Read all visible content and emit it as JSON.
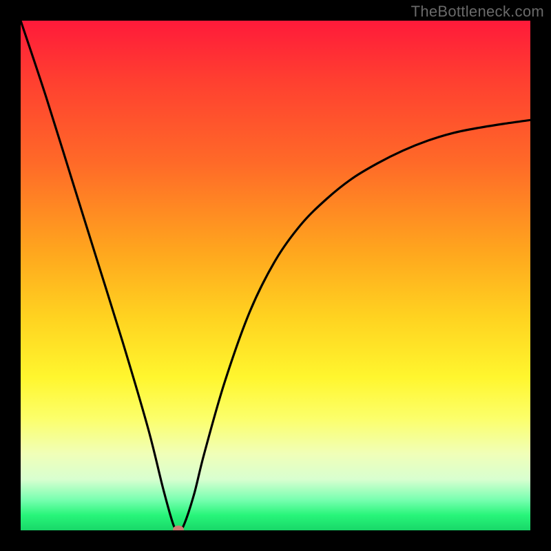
{
  "watermark": "TheBottleneck.com",
  "colors": {
    "frame": "#000000",
    "curve": "#000000",
    "marker": "#cb7f73"
  },
  "chart_data": {
    "type": "line",
    "title": "",
    "xlabel": "",
    "ylabel": "",
    "xlim": [
      0,
      100
    ],
    "ylim": [
      0,
      100
    ],
    "grid": false,
    "legend": false,
    "series": [
      {
        "name": "bottleneck-curve",
        "x": [
          0,
          5,
          10,
          15,
          20,
          25,
          28,
          30,
          31,
          32,
          34,
          36,
          40,
          45,
          50,
          55,
          60,
          65,
          70,
          75,
          80,
          85,
          90,
          95,
          100
        ],
        "y": [
          100,
          85,
          69,
          53,
          37,
          20,
          8,
          1,
          0,
          1,
          7,
          15,
          29,
          43,
          53,
          60,
          65,
          69,
          72,
          74.5,
          76.5,
          78,
          79,
          79.8,
          80.5
        ]
      }
    ],
    "marker": {
      "x": 31,
      "y": 0
    },
    "notes": "V-shaped bottleneck curve on rainbow heatmap gradient; minimum (optimal point) near x≈31 at y≈0. Values estimated from pixel positions; image has no axis ticks or numeric labels."
  }
}
